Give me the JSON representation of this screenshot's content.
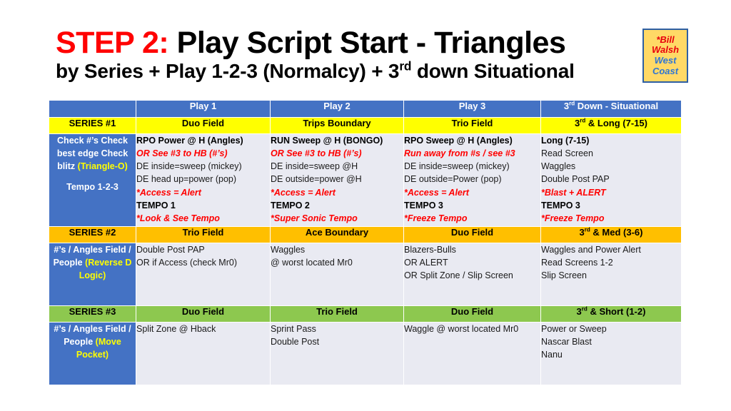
{
  "title": {
    "step_label": "STEP 2:",
    "main": "Play Script Start - Triangles",
    "subtitle_pre": "by Series + Play 1-2-3 (Normalcy) + 3",
    "subtitle_sup": "rd",
    "subtitle_post": " down Situational"
  },
  "stamp": {
    "line1": "*Bill",
    "line2": "Walsh",
    "line3": "West",
    "line4": "Coast"
  },
  "colors": {
    "blue": "#4472C4",
    "yellow": "#FFFF00",
    "orange": "#FFBF00",
    "green": "#8DC84F",
    "cell_bg": "#E9EAF2",
    "red_text": "#FF0000",
    "stamp_bg": "#FFD966"
  },
  "table": {
    "header": {
      "corner": "",
      "col1": "Play 1",
      "col2": "Play 2",
      "col3": "Play 3",
      "col4_pre": "3",
      "col4_sup": "rd",
      "col4_post": " Down - Situational"
    },
    "series1": {
      "band": {
        "label": "SERIES #1",
        "play1": "Duo Field",
        "play2": "Trips Boundary",
        "play3": "Trio Field",
        "situational_pre": "3",
        "situational_sup": "rd",
        "situational_post": " & Long (7-15)"
      },
      "label_cell": {
        "l1": "Check #’s",
        "l2": "Check best edge",
        "l3": "Check blitz",
        "l4": "(Triangle-O)",
        "l5": "Tempo 1-2-3"
      },
      "play1": [
        "RPO Power @ H (Angles)",
        "OR See #3 to HB (#’s)",
        "DE inside=sweep (mickey)",
        "DE head up=power (pop)",
        "*Access = Alert",
        "TEMPO 1",
        "*Look & See Tempo"
      ],
      "play2": [
        "RUN Sweep @ H (BONGO)",
        "OR See #3 to HB (#’s)",
        "DE inside=sweep @H",
        "DE outside=power @H",
        "*Access = Alert",
        "TEMPO 2",
        "*Super Sonic Tempo"
      ],
      "play3": [
        "RPO Sweep @ H (Angles)",
        "Run away from #s / see #3",
        "DE inside=sweep (mickey)",
        "DE outside=Power (pop)",
        "*Access = Alert",
        "TEMPO 3",
        "*Freeze Tempo"
      ],
      "situational": [
        "Long (7-15)",
        "Read Screen",
        "Waggles",
        "Double Post PAP",
        "*Blast + ALERT",
        "TEMPO 3",
        "*Freeze Tempo"
      ]
    },
    "series2": {
      "band": {
        "label": "SERIES #2",
        "play1": "Trio Field",
        "play2": "Ace Boundary",
        "play3": "Duo Field",
        "situational_pre": "3",
        "situational_sup": "rd",
        "situational_post": " & Med (3-6)"
      },
      "label_cell": {
        "l1": "#’s / Angles",
        "l2": "Field / People",
        "l3": "(Reverse D Logic)"
      },
      "play1": [
        "Double Post PAP",
        "OR if Access (check Mr0)"
      ],
      "play2": [
        "Waggles",
        "@ worst located Mr0"
      ],
      "play3": [
        "Blazers-Bulls",
        "OR ALERT",
        "OR Split Zone / Slip Screen"
      ],
      "situational": [
        "Waggles and Power Alert",
        "Read Screens 1-2",
        "Slip Screen"
      ]
    },
    "series3": {
      "band": {
        "label": "SERIES #3",
        "play1": "Duo Field",
        "play2": "Trio Field",
        "play3": "Duo Field",
        "situational_pre": "3",
        "situational_sup": "rd",
        "situational_post": " & Short (1-2)"
      },
      "label_cell": {
        "l1": "#’s / Angles",
        "l2": "Field / People",
        "l3": "(Move Pocket)"
      },
      "play1": [
        "Split Zone @ Hback"
      ],
      "play2": [
        "Sprint Pass",
        "Double Post"
      ],
      "play3": [
        "Waggle @ worst located Mr0"
      ],
      "situational": [
        "Power or Sweep",
        "Nascar Blast",
        "Nanu"
      ]
    }
  }
}
